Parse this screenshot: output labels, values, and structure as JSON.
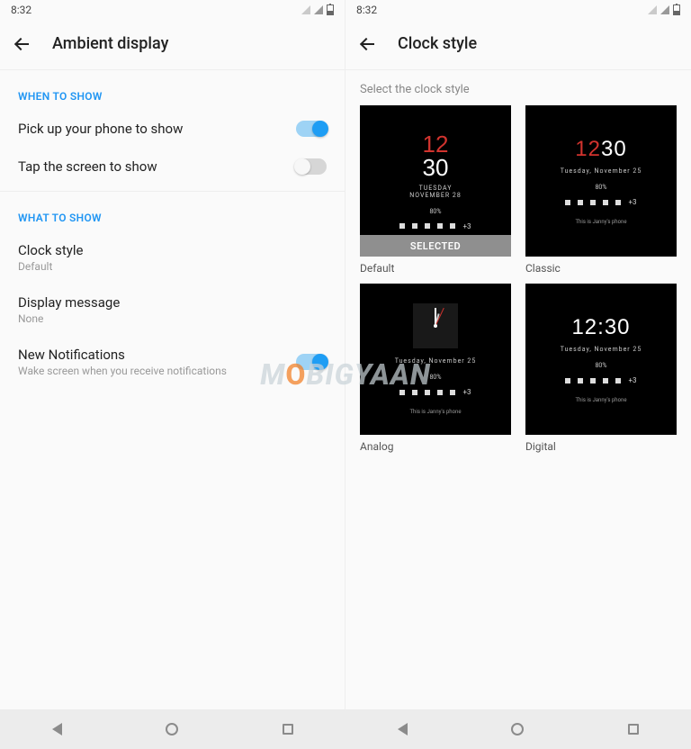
{
  "status_time": "8:32",
  "left": {
    "title": "Ambient display",
    "section_when": "WHEN TO SHOW",
    "section_what": "WHAT TO SHOW",
    "pickup_label": "Pick up your phone to show",
    "tap_label": "Tap the screen to show",
    "clock_style_label": "Clock style",
    "clock_style_value": "Default",
    "display_msg_label": "Display message",
    "display_msg_value": "None",
    "new_notif_label": "New Notifications",
    "new_notif_sub": "Wake screen when you receive notifications"
  },
  "right": {
    "title": "Clock style",
    "hint": "Select the clock style",
    "selected_label": "SELECTED",
    "cards": {
      "default": "Default",
      "classic": "Classic",
      "analog": "Analog",
      "digital": "Digital"
    }
  },
  "preview": {
    "time_hh": "12",
    "time_mm": "30",
    "day_upper": "TUESDAY",
    "date_upper_28": "NOVEMBER 28",
    "date_line_25": "Tuesday, November 25",
    "battery_pct": "80%",
    "more_count": "+3",
    "owner": "This is Janny's phone"
  },
  "watermark_a": "M",
  "watermark_o": "O",
  "watermark_b": "BIGYAAN"
}
